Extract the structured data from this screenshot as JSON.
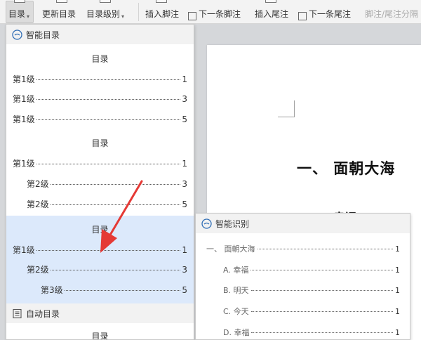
{
  "ribbon": {
    "toc_label": "目录",
    "update_toc_label": "更新目录",
    "toc_level_label": "目录级别",
    "insert_footnote_label": "插入脚注",
    "next_footnote_label": "下一条脚注",
    "insert_endnote_label": "插入尾注",
    "next_endnote_label": "下一条尾注",
    "footnote_endnote_sep_label": "脚注/尾注分隔"
  },
  "smart_toc": {
    "header": "智能目录",
    "styles": [
      {
        "title": "目录",
        "entries": [
          {
            "label": "第1级",
            "page": "1"
          },
          {
            "label": "第1级",
            "page": "3"
          },
          {
            "label": "第1级",
            "page": "5"
          }
        ]
      },
      {
        "title": "目录",
        "entries": [
          {
            "label": "第1级",
            "page": "1"
          },
          {
            "label": "第2级",
            "page": "3"
          },
          {
            "label": "第2级",
            "page": "5"
          }
        ]
      },
      {
        "title": "目录",
        "entries": [
          {
            "label": "第1级",
            "page": "1"
          },
          {
            "label": "第2级",
            "page": "3"
          },
          {
            "label": "第3级",
            "page": "5"
          }
        ]
      }
    ]
  },
  "auto_toc": {
    "header": "自动目录",
    "title": "目录"
  },
  "smart_recognition": {
    "header": "智能识别",
    "entries": [
      {
        "label": "一、 面朝大海",
        "page": "1"
      },
      {
        "label": "A. 幸福",
        "page": "1"
      },
      {
        "label": "B. 明天",
        "page": "1"
      },
      {
        "label": "C. 今天",
        "page": "1"
      },
      {
        "label": "D. 幸福",
        "page": "1"
      }
    ]
  },
  "document": {
    "heading1": "一、 面朝大海",
    "heading2": "A. 幸福"
  },
  "colors": {
    "highlight": "#dce9fb",
    "arrow": "#e53935",
    "header_icon": "#2f6db5"
  }
}
